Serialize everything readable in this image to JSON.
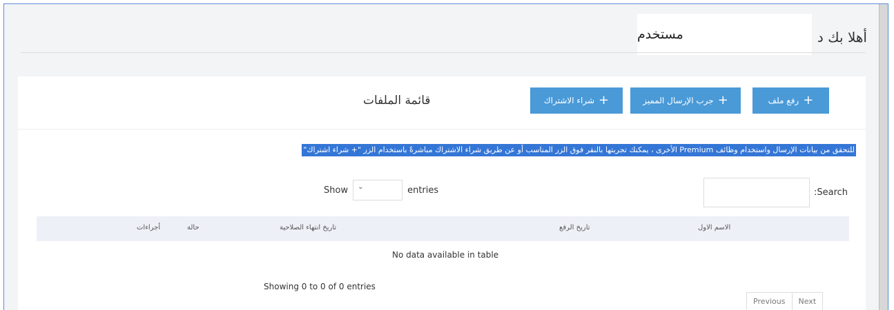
{
  "header": {
    "welcome": "أهلا بك د",
    "user_name": "مستخدم"
  },
  "card": {
    "title": "قائمة الملفات",
    "buttons": {
      "upload": "رفع ملف",
      "try_premium": "جرب الإرسال المميز",
      "buy_subscription": "شراء الاشتراك"
    },
    "notice": "للتحقق من بيانات الإرسال واستخدام وظائف Premium الأخرى ، يمكنك تجربتها بالنقر فوق الزر المناسب أو عن طريق شراء الاشتراك مباشرةً باستخدام الزر \"+ شراء اشتراك\""
  },
  "table_controls": {
    "show_label": "Show",
    "entries_label": "entries",
    "search_label": ":Search"
  },
  "table": {
    "columns": [
      "الاسم الاول",
      "تاريخ الرفع",
      "تاريخ انتهاء الصلاحية",
      "حالة",
      "أجراءات"
    ],
    "empty_message": "No data available in table",
    "info": "Showing 0 to 0 of 0 entries"
  },
  "pagination": {
    "previous": "Previous",
    "next": "Next"
  },
  "colors": {
    "accent": "#4a9ad8",
    "notice_bg": "#3476d6",
    "table_header_bg": "#eef0f7"
  }
}
